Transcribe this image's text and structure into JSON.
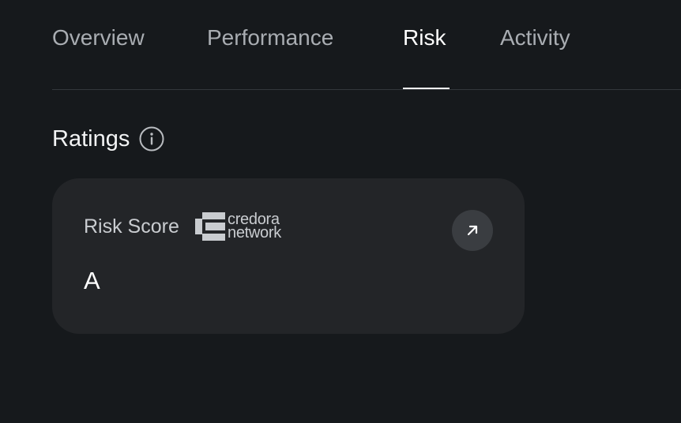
{
  "tabs": [
    {
      "label": "Overview"
    },
    {
      "label": "Performance"
    },
    {
      "label": "Risk",
      "active": true
    },
    {
      "label": "Activity"
    }
  ],
  "ratings": {
    "title": "Ratings",
    "info_icon": "info-icon"
  },
  "risk_card": {
    "label": "Risk Score",
    "provider_logo_text": [
      "credora",
      "network"
    ],
    "value": "A",
    "link_icon": "arrow-up-right-icon"
  },
  "colors": {
    "background": "#16191c",
    "card": "#232528",
    "tab_inactive": "#a9adb2",
    "tab_active": "#ffffff"
  }
}
